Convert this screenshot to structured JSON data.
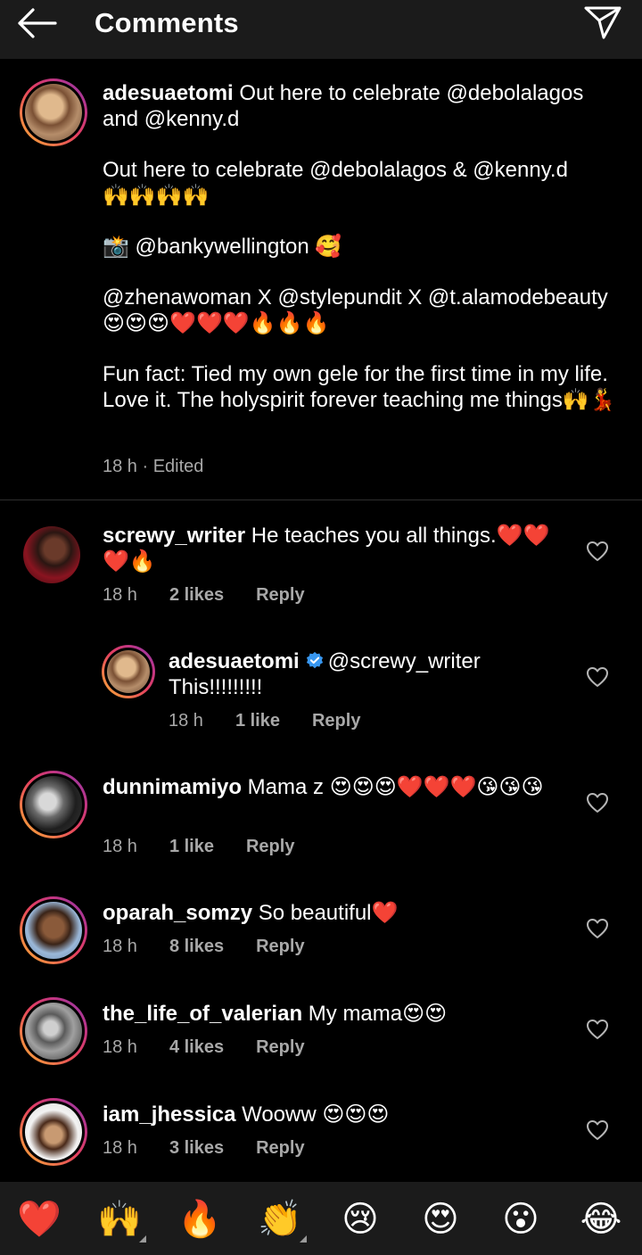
{
  "header": {
    "title": "Comments"
  },
  "caption": {
    "username": "adesuaetomi",
    "line1_text": " Out here to celebrate @debolalagos and @kenny.d",
    "line2_text": "Out here to celebrate @debolalagos & @kenny.d",
    "line2_emoji": "🙌🙌🙌🙌",
    "line3_emoji_lead": "📸",
    "line3_text": " @bankywellington ",
    "line3_emoji_tail": "🥰",
    "line4_text": "@zhenawoman X @stylepundit X @t.alamodebeauty ",
    "line4_emoji": "😍😍😍❤️❤️❤️🔥🔥🔥",
    "line5_text": "Fun fact: Tied my own gele for the first time in my life. Love it. The holyspirit forever teaching me things",
    "line5_emoji": "🙌💃",
    "meta": "18 h · Edited"
  },
  "comments": [
    {
      "username": "screwy_writer",
      "text": " He teaches you all things.",
      "emoji": "❤️❤️❤️🔥",
      "time": "18 h",
      "likes": "2 likes",
      "reply": "Reply"
    },
    {
      "username": "adesuaetomi",
      "mention": "@screwy_writer",
      "text": "This!!!!!!!!!",
      "time": "18 h",
      "likes": "1 like",
      "reply": "Reply"
    },
    {
      "username": "dunnimamiyo",
      "text": " Mama z ",
      "emoji": "😍😍😍❤️❤️❤️😘😘😘",
      "time": "18 h",
      "likes": "1 like",
      "reply": "Reply"
    },
    {
      "username": "oparah_somzy",
      "text": " So beautiful",
      "emoji": "❤️",
      "time": "18 h",
      "likes": "8 likes",
      "reply": "Reply"
    },
    {
      "username": "the_life_of_valerian",
      "text": " My mama",
      "emoji": "😍😍",
      "time": "18 h",
      "likes": "4 likes",
      "reply": "Reply"
    },
    {
      "username": "iam_jhessica",
      "text": " Wooww ",
      "emoji": "😍😍😍",
      "time": "18 h",
      "likes": "3 likes",
      "reply": "Reply"
    }
  ],
  "emoji_bar": [
    "❤️",
    "🙌",
    "🔥",
    "👏",
    "😢",
    "😍",
    "😮",
    "😂"
  ],
  "colors": {
    "background": "#000000",
    "header": "#1b1b1b",
    "meta_text": "#a8a8a8",
    "verified": "#3897f0"
  }
}
